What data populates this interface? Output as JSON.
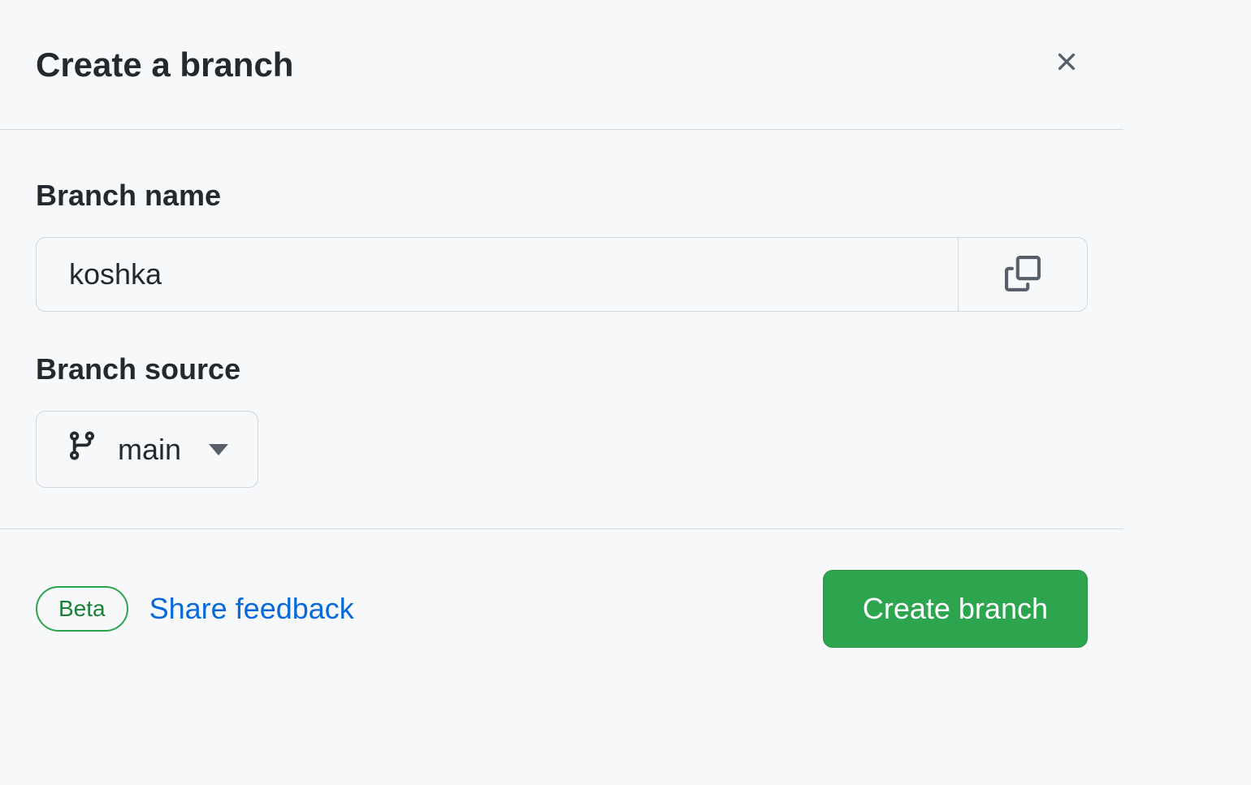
{
  "dialog": {
    "title": "Create a branch",
    "branch_name": {
      "label": "Branch name",
      "value": "koshka"
    },
    "branch_source": {
      "label": "Branch source",
      "selected": "main"
    },
    "footer": {
      "beta_label": "Beta",
      "feedback_label": "Share feedback",
      "create_button_label": "Create branch"
    }
  }
}
